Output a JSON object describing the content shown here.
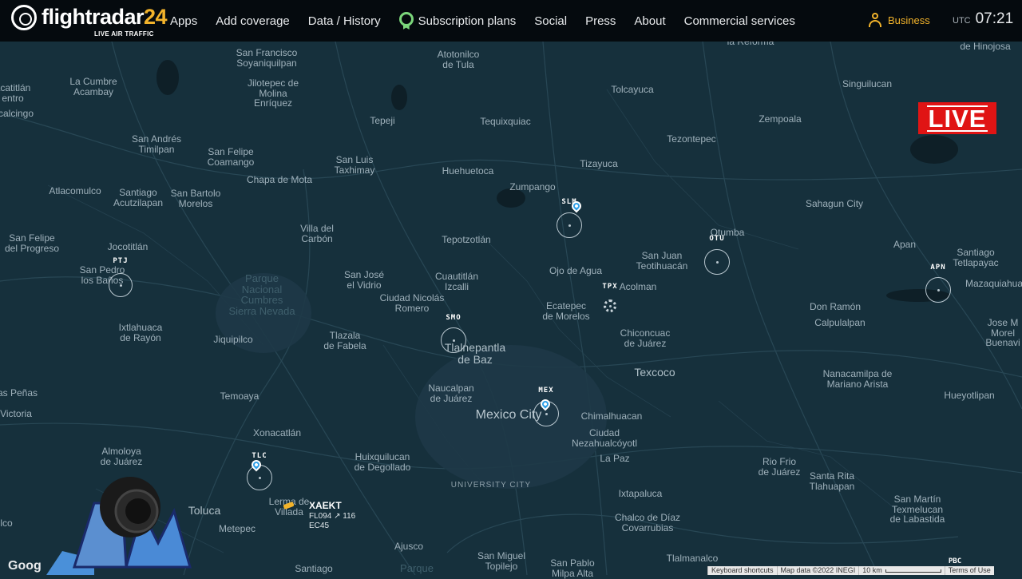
{
  "header": {
    "logo_text_a": "flightradar",
    "logo_text_b": "24",
    "logo_tagline": "LIVE AIR TRAFFIC",
    "nav": [
      "Apps",
      "Add coverage",
      "Data / History",
      "Subscription plans",
      "Social",
      "Press",
      "About",
      "Commercial services"
    ],
    "business_label": "Business",
    "timezone": "UTC",
    "time": "07:21"
  },
  "live_badge": "LIVE",
  "map": {
    "place_labels": [
      {
        "text": "San Francisco\nSoyaniquilpan",
        "cls": ""
      },
      {
        "text": "Atotonilco\nde Tula",
        "cls": ""
      },
      {
        "text": "la Reforma",
        "cls": ""
      },
      {
        "text": "de Hinojosa",
        "cls": ""
      },
      {
        "text": "La Cumbre\nAcambay",
        "cls": ""
      },
      {
        "text": "acatitlán\nentro",
        "cls": ""
      },
      {
        "text": "Jilotepec de\nMolina\nEnríquez",
        "cls": ""
      },
      {
        "text": "Tolcayuca",
        "cls": ""
      },
      {
        "text": "Singuilucan",
        "cls": ""
      },
      {
        "text": "calcingo",
        "cls": ""
      },
      {
        "text": "Tepeji",
        "cls": ""
      },
      {
        "text": "Tequixquiac",
        "cls": ""
      },
      {
        "text": "Zempoala",
        "cls": ""
      },
      {
        "text": "San Andrés\nTimilpan",
        "cls": ""
      },
      {
        "text": "Tezontepec",
        "cls": ""
      },
      {
        "text": "San Felipe\nCoamango",
        "cls": ""
      },
      {
        "text": "San Luis\nTaxhimay",
        "cls": ""
      },
      {
        "text": "Huehuetoca",
        "cls": ""
      },
      {
        "text": "Tizayuca",
        "cls": ""
      },
      {
        "text": "Chapa de Mota",
        "cls": ""
      },
      {
        "text": "Zumpango",
        "cls": ""
      },
      {
        "text": "Atlacomulco",
        "cls": ""
      },
      {
        "text": "Santiago\nAcutzilapan",
        "cls": ""
      },
      {
        "text": "San Bartolo\nMorelos",
        "cls": ""
      },
      {
        "text": "Sahagun City",
        "cls": ""
      },
      {
        "text": "Villa del\nCarbón",
        "cls": ""
      },
      {
        "text": "San Felipe\ndel Progreso",
        "cls": ""
      },
      {
        "text": "Jocotitlán",
        "cls": ""
      },
      {
        "text": "Tepotzotlán",
        "cls": ""
      },
      {
        "text": "Apan",
        "cls": ""
      },
      {
        "text": "San Juan\nTeotihuacán",
        "cls": ""
      },
      {
        "text": "Santiago\nTetlapayac",
        "cls": ""
      },
      {
        "text": "San Pedro\nlos Baños",
        "cls": ""
      },
      {
        "text": "Ojo de Agua",
        "cls": ""
      },
      {
        "text": "Cuautitlán\nIzcalli",
        "cls": ""
      },
      {
        "text": "Parque\nNacional\nCumbres\nSierra Nevada",
        "cls": "park"
      },
      {
        "text": "San José\nel Vidrio",
        "cls": ""
      },
      {
        "text": "Acolman",
        "cls": ""
      },
      {
        "text": "Mazaquiahua",
        "cls": ""
      },
      {
        "text": "Ciudad Nicolás\nRomero",
        "cls": ""
      },
      {
        "text": "Ecatepec\nde Morelos",
        "cls": ""
      },
      {
        "text": "Don Ramón",
        "cls": ""
      },
      {
        "text": "Calpulalpan",
        "cls": ""
      },
      {
        "text": "Ixtlahuaca\nde Rayón",
        "cls": ""
      },
      {
        "text": "Jose M\nMorel\nBuenavi",
        "cls": ""
      },
      {
        "text": "Chiconcuac\nde Juárez",
        "cls": ""
      },
      {
        "text": "Jiquipilco",
        "cls": ""
      },
      {
        "text": "Tlazala\nde Fabela",
        "cls": ""
      },
      {
        "text": "Tlalnepantla\nde Baz",
        "cls": "mid"
      },
      {
        "text": "Texcoco",
        "cls": "mid"
      },
      {
        "text": "Nanacamilpa de\nMariano Arista",
        "cls": ""
      },
      {
        "text": "Naucalpan\nde Juárez",
        "cls": ""
      },
      {
        "text": "as Peñas",
        "cls": ""
      },
      {
        "text": "Temoaya",
        "cls": ""
      },
      {
        "text": "Hueyotlipan",
        "cls": ""
      },
      {
        "text": "Victoria",
        "cls": ""
      },
      {
        "text": "Mexico City",
        "cls": "big"
      },
      {
        "text": "Chimalhuacan",
        "cls": ""
      },
      {
        "text": "Xonacatlán",
        "cls": ""
      },
      {
        "text": "Ciudad\nNezahualcóyotl",
        "cls": ""
      },
      {
        "text": "Almoloya\nde Juárez",
        "cls": ""
      },
      {
        "text": "Huixquilucan\nde Degollado",
        "cls": ""
      },
      {
        "text": "La Paz",
        "cls": ""
      },
      {
        "text": "Rio Frio\nde Juárez",
        "cls": ""
      },
      {
        "text": "Santa Rita\nTlahuapan",
        "cls": ""
      },
      {
        "text": "UNIVERSITY CITY",
        "cls": "univ"
      },
      {
        "text": "Ixtapaluca",
        "cls": ""
      },
      {
        "text": "Lerma de\nVillada",
        "cls": ""
      },
      {
        "text": "Toluca",
        "cls": "mid"
      },
      {
        "text": "San Martín\nTexmelucan\nde Labastida",
        "cls": ""
      },
      {
        "text": "Metepec",
        "cls": ""
      },
      {
        "text": "Chalco de Díaz\nCovarrubias",
        "cls": ""
      },
      {
        "text": "lco",
        "cls": ""
      },
      {
        "text": "Ajusco",
        "cls": ""
      },
      {
        "text": "San Miguel\nTopilejo",
        "cls": ""
      },
      {
        "text": "Tlalmanalco",
        "cls": ""
      },
      {
        "text": "Parque",
        "cls": "park"
      },
      {
        "text": "San Pablo\nMilpa Alta",
        "cls": ""
      },
      {
        "text": "Santiago",
        "cls": ""
      },
      {
        "text": "Otumba",
        "cls": ""
      }
    ],
    "airports": [
      {
        "code": "SLM",
        "pin": true
      },
      {
        "code": "OTU",
        "pin": false
      },
      {
        "code": "APN",
        "pin": false
      },
      {
        "code": "PTJ",
        "pin": false
      },
      {
        "code": "TPX",
        "pin": false
      },
      {
        "code": "SMO",
        "pin": false
      },
      {
        "code": "MEX",
        "pin": true
      },
      {
        "code": "TLC",
        "pin": true
      }
    ],
    "flight": {
      "callsign": "XAEKT",
      "level_line": "FL094 ↗ 116",
      "type": "EC45"
    },
    "corner_airport": "PBC"
  },
  "footer": {
    "google": "Goog",
    "shortcuts": "Keyboard shortcuts",
    "map_data": "Map data ©2022 INEGI",
    "scale": "10 km",
    "terms": "Terms of Use"
  },
  "colors": {
    "map_bg": "#16303c",
    "topbar": "#050a0e",
    "brand_yellow": "#f2b32b",
    "live_red": "#e01414",
    "pin_blue": "#2ea0e8"
  }
}
